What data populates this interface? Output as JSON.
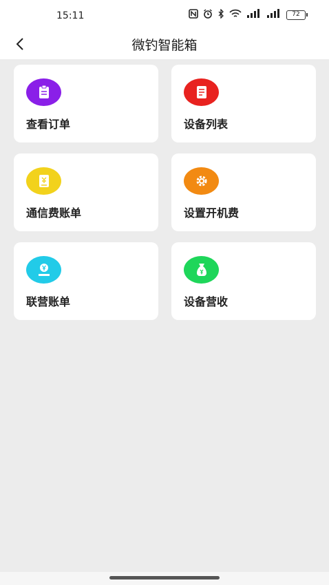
{
  "status_bar": {
    "time": "15:11",
    "battery": "72",
    "icons": [
      "nfc-icon",
      "alarm-icon",
      "bluetooth-icon",
      "wifi-icon",
      "signal-icon",
      "signal-icon"
    ]
  },
  "header": {
    "title": "微钓智能箱"
  },
  "menu": {
    "items": [
      {
        "label": "查看订单",
        "icon": "order-clipboard-icon",
        "color": "#8a1fe8"
      },
      {
        "label": "设备列表",
        "icon": "device-list-icon",
        "color": "#e8221f"
      },
      {
        "label": "通信费账单",
        "icon": "bill-document-icon",
        "color": "#f2d21c"
      },
      {
        "label": "设置开机费",
        "icon": "gear-icon",
        "color": "#f28a12"
      },
      {
        "label": "联营账单",
        "icon": "yen-hand-icon",
        "color": "#22cbe8"
      },
      {
        "label": "设备营收",
        "icon": "money-bag-icon",
        "color": "#1ed65a"
      }
    ]
  }
}
